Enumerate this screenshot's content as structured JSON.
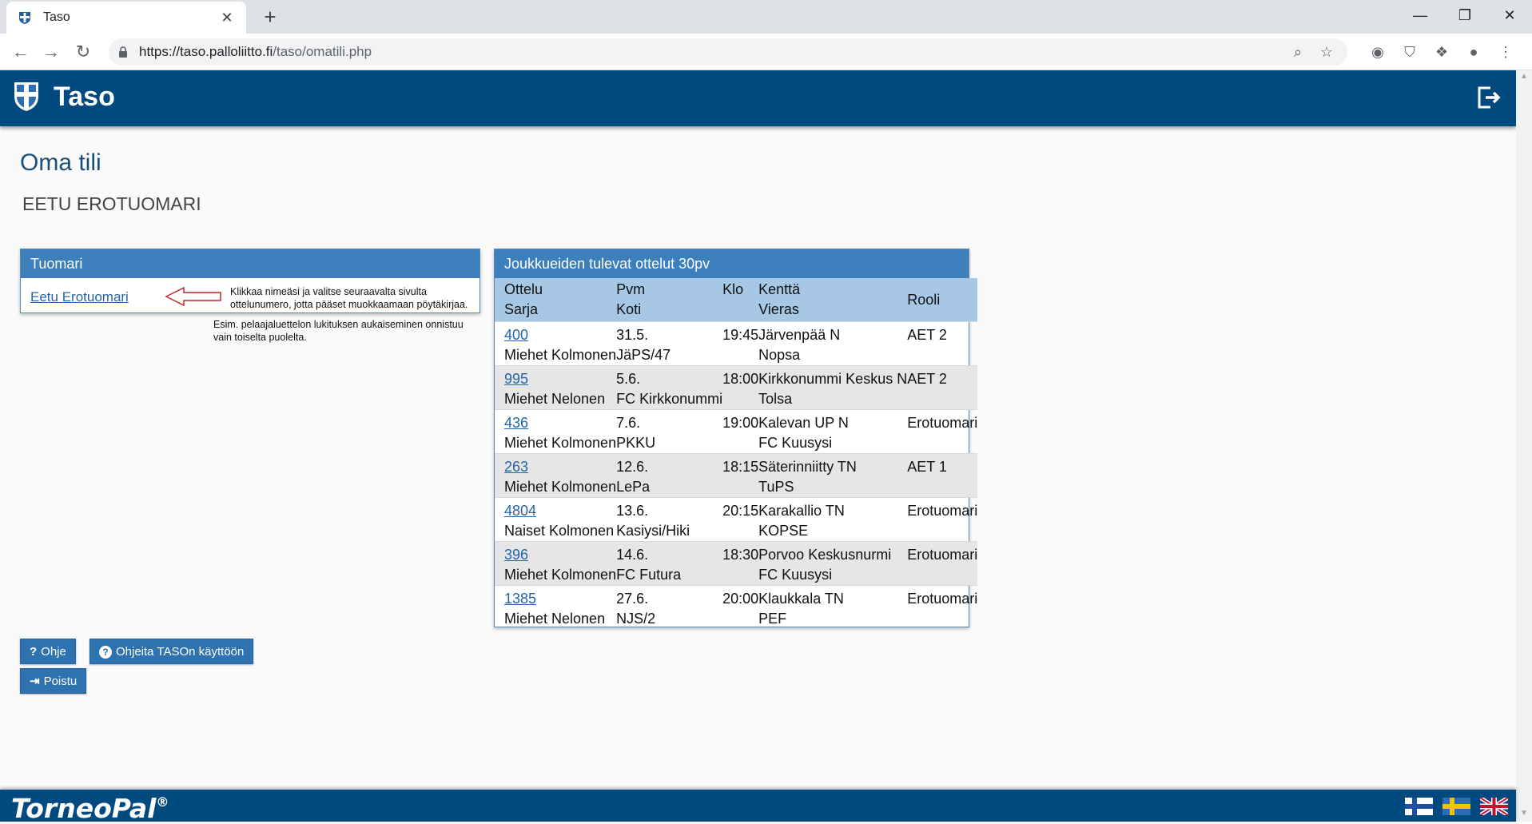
{
  "browser": {
    "tab_title": "Taso",
    "tab_close": "✕",
    "new_tab": "+",
    "url_host": "https://taso.palloliitto.fi",
    "url_path": "/taso/omatili.php",
    "window_minimize": "—",
    "window_restore": "❐",
    "window_close": "✕"
  },
  "app": {
    "title": "Taso"
  },
  "page": {
    "title": "Oma tili",
    "user_name": "EETU EROTUOMARI"
  },
  "referee_panel": {
    "heading": "Tuomari",
    "link": "Eetu Erotuomari",
    "help_text_1": "Klikkaa nimeäsi ja valitse seuraavalta sivulta ottelunumero, jotta pääset muokkaamaan pöytäkirjaa.",
    "help_text_2": "Esim. pelaajaluettelon lukituksen aukaiseminen onnistuu vain toiselta puolelta."
  },
  "matches_panel": {
    "heading": "Joukkueiden tulevat ottelut 30pv",
    "columns": {
      "c1a": "Ottelu",
      "c1b": "Sarja",
      "c2a": "Pvm",
      "c2b": "Koti",
      "c3a": "Klo",
      "c4a": "Kenttä",
      "c4b": "Vieras",
      "c5a": "Rooli"
    },
    "rows": [
      {
        "ottelu": "400",
        "sarja": "Miehet Kolmonen",
        "pvm": "31.5.",
        "koti": "JäPS/47",
        "klo": "19:45",
        "kentta": "Järvenpää N",
        "vieras": "Nopsa",
        "rooli": "AET 2"
      },
      {
        "ottelu": "995",
        "sarja": "Miehet Nelonen",
        "pvm": "5.6.",
        "koti": "FC Kirkkonummi",
        "klo": "18:00",
        "kentta": "Kirkkonummi Keskus N",
        "vieras": "Tolsa",
        "rooli": "AET 2"
      },
      {
        "ottelu": "436",
        "sarja": "Miehet Kolmonen",
        "pvm": "7.6.",
        "koti": "PKKU",
        "klo": "19:00",
        "kentta": "Kalevan UP N",
        "vieras": "FC Kuusysi",
        "rooli": "Erotuomari"
      },
      {
        "ottelu": "263",
        "sarja": "Miehet Kolmonen",
        "pvm": "12.6.",
        "koti": "LePa",
        "klo": "18:15",
        "kentta": "Säterinniitty TN",
        "vieras": "TuPS",
        "rooli": "AET 1"
      },
      {
        "ottelu": "4804",
        "sarja": "Naiset Kolmonen",
        "pvm": "13.6.",
        "koti": "Kasiysi/Hiki",
        "klo": "20:15",
        "kentta": "Karakallio TN",
        "vieras": "KOPSE",
        "rooli": "Erotuomari"
      },
      {
        "ottelu": "396",
        "sarja": "Miehet Kolmonen",
        "pvm": "14.6.",
        "koti": "FC Futura",
        "klo": "18:30",
        "kentta": "Porvoo Keskusnurmi",
        "vieras": "FC Kuusysi",
        "rooli": "Erotuomari"
      },
      {
        "ottelu": "1385",
        "sarja": "Miehet Nelonen",
        "pvm": "27.6.",
        "koti": "NJS/2",
        "klo": "20:00",
        "kentta": "Klaukkala TN",
        "vieras": "PEF",
        "rooli": "Erotuomari"
      }
    ]
  },
  "buttons": {
    "help": "Ohje",
    "help_icon": "?",
    "guides": "Ohjeita TASOn käyttöön",
    "guides_icon": "?",
    "logout": "Poistu",
    "logout_icon": "⇥"
  },
  "footer": {
    "brand": "TorneoPal",
    "registered": "®"
  },
  "colors": {
    "header_blue": "#004a80",
    "panel_head": "#3d7fba",
    "table_head": "#a6c8e4",
    "link": "#2464a8"
  }
}
